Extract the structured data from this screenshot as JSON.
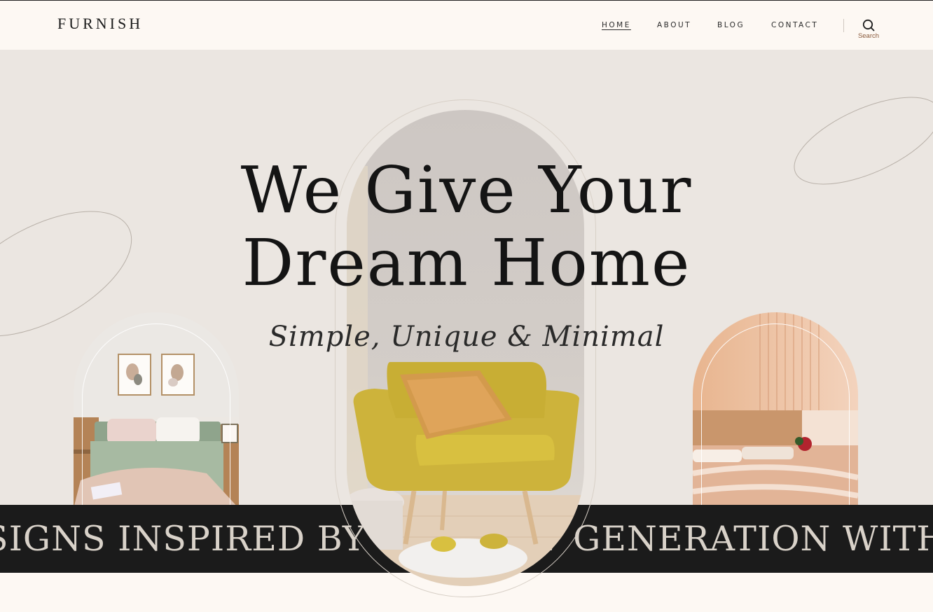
{
  "brand": {
    "logo_text": "FURNISH"
  },
  "nav": {
    "items": [
      {
        "label": "HOME",
        "active": true
      },
      {
        "label": "ABOUT",
        "active": false
      },
      {
        "label": "BLOG",
        "active": false
      },
      {
        "label": "CONTACT",
        "active": false
      }
    ],
    "search_label": "Search"
  },
  "hero": {
    "headline_line1": "We Give Your",
    "headline_line2": "Dream Home",
    "tagline": "Simple, Unique & Minimal",
    "images": {
      "left": "bedroom-green-bedding",
      "center": "yellow-armchair",
      "right": "bedroom-wood-panel"
    }
  },
  "ticker": {
    "text": "SIGNS INSPIRED BY THE NEW GENERATION WITH A CLASSIC"
  },
  "colors": {
    "header_bg": "#fdf8f3",
    "hero_bg": "#ebe6e1",
    "ticker_bg": "#1b1b1b",
    "text_dark": "#141414",
    "accent_brown": "#8a5a3c"
  }
}
